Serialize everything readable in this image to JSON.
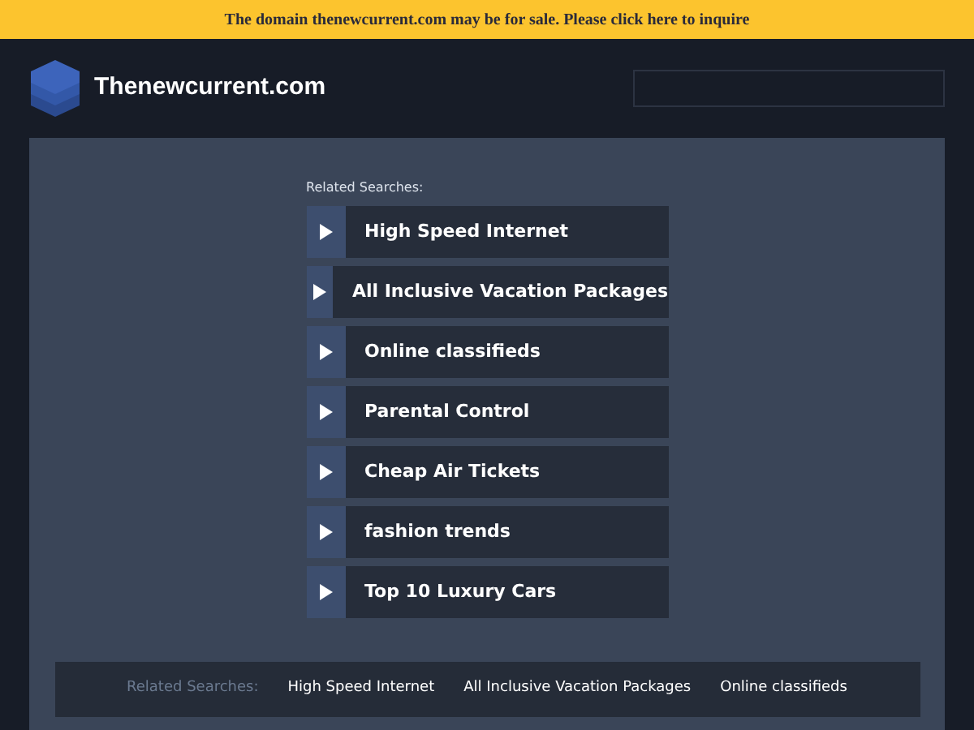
{
  "banner": {
    "text": "The domain thenewcurrent.com may be for sale. Please click here to inquire"
  },
  "header": {
    "site_name": "Thenewcurrent.com"
  },
  "related": {
    "heading": "Related Searches:",
    "links": [
      {
        "label": "High Speed Internet"
      },
      {
        "label": "All Inclusive Vacation Packages"
      },
      {
        "label": "Online classifieds"
      },
      {
        "label": "Parental Control"
      },
      {
        "label": "Cheap Air Tickets"
      },
      {
        "label": "fashion trends"
      },
      {
        "label": "Top 10 Luxury Cars"
      }
    ]
  },
  "footer_bar": {
    "heading": "Related Searches:",
    "links": [
      "High Speed Internet",
      "All Inclusive Vacation Packages",
      "Online classifieds"
    ]
  }
}
